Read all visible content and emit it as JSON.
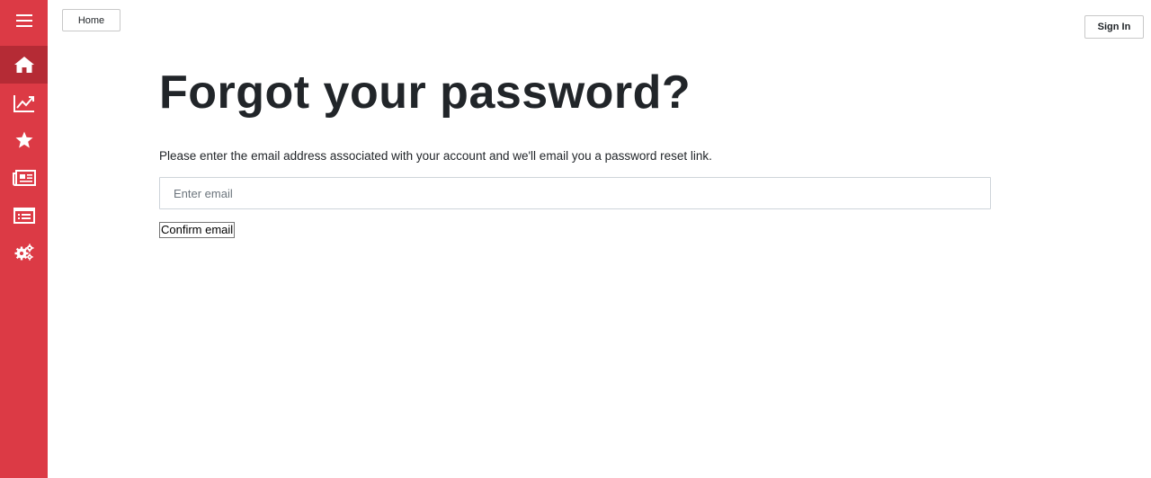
{
  "header": {
    "home_label": "Home",
    "signin_label": "Sign In"
  },
  "sidebar": {
    "items": [
      {
        "icon": "menu-icon",
        "active": false
      },
      {
        "icon": "home-icon",
        "active": true
      },
      {
        "icon": "chart-line-icon",
        "active": false
      },
      {
        "icon": "star-icon",
        "active": false
      },
      {
        "icon": "newspaper-icon",
        "active": false
      },
      {
        "icon": "list-icon",
        "active": false
      },
      {
        "icon": "gears-icon",
        "active": false
      }
    ],
    "color": "#dc3a45",
    "active_color": "#b52b35"
  },
  "main": {
    "title": "Forgot your password?",
    "description": "Please enter the email address associated with your account and we'll email you a password reset link.",
    "email_placeholder": "Enter email",
    "email_value": "",
    "confirm_label": "Confirm email"
  }
}
